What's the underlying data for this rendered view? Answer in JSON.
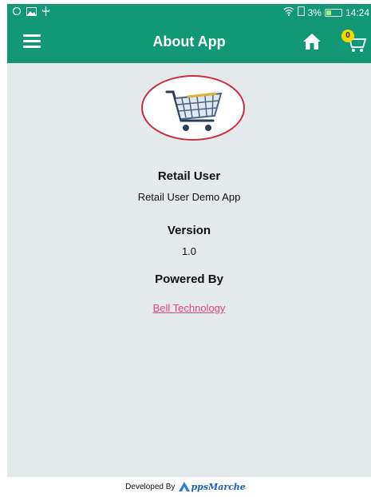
{
  "statusbar": {
    "battery": "3%",
    "time": "14:24",
    "battery_level": 0.35
  },
  "appbar": {
    "title": "About App",
    "cart_count": "0"
  },
  "about": {
    "app_name": "Retail User",
    "app_description": "Retail User Demo App",
    "version_label": "Version",
    "version_value": "1.0",
    "powered_by_label": "Powered By",
    "powered_by_link": "Bell Technology"
  },
  "footer": {
    "developed_by": "Developed By",
    "brand_suffix": "ppsMarche"
  },
  "colors": {
    "primary": "#139877",
    "background": "#e4e9ec",
    "link": "#e0457c",
    "badge": "#f5d800"
  }
}
